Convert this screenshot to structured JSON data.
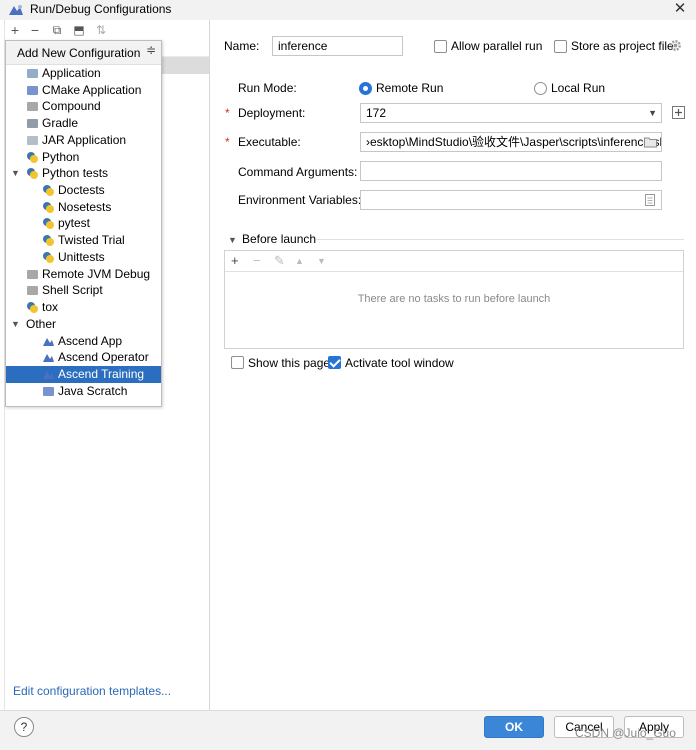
{
  "window": {
    "title": "Run/Debug Configurations",
    "close_glyph": "✕",
    "icon": "ascend-config-icon"
  },
  "left_toolbar": {
    "add_glyph": "+",
    "remove_glyph": "−",
    "copy_glyph": "⧉",
    "move_glyph": "⬒",
    "sort_glyph": "⇅"
  },
  "popup": {
    "title": "Add New Configuration",
    "collapse_glyph": "≑",
    "items": [
      {
        "label": "Application",
        "icon": "application-icon",
        "color": "#6e90b8",
        "level": 1
      },
      {
        "label": "CMake Application",
        "icon": "cmake-icon",
        "color": "#4a70c0",
        "level": 1
      },
      {
        "label": "Compound",
        "icon": "compound-icon",
        "color": "#8b8b8b",
        "level": 1
      },
      {
        "label": "Gradle",
        "icon": "gradle-icon",
        "color": "#6b7b8b",
        "level": 1
      },
      {
        "label": "JAR Application",
        "icon": "jar-icon",
        "color": "#9aa8b8",
        "level": 1
      },
      {
        "label": "Python",
        "icon": "python-icon",
        "color": "#3a76b0",
        "level": 1
      },
      {
        "label": "Python tests",
        "icon": "python-tests-icon",
        "color": "#3a76b0",
        "level": 1,
        "expanded": true
      },
      {
        "label": "Doctests",
        "icon": "python-test-icon",
        "color": "#3a76b0",
        "level": 2
      },
      {
        "label": "Nosetests",
        "icon": "python-test-icon",
        "color": "#3a76b0",
        "level": 2
      },
      {
        "label": "pytest",
        "icon": "python-test-icon",
        "color": "#3a76b0",
        "level": 2
      },
      {
        "label": "Twisted Trial",
        "icon": "python-test-icon",
        "color": "#3a76b0",
        "level": 2
      },
      {
        "label": "Unittests",
        "icon": "python-test-icon",
        "color": "#3a76b0",
        "level": 2
      },
      {
        "label": "Remote JVM Debug",
        "icon": "remote-debug-icon",
        "color": "#8b8b8b",
        "level": 1
      },
      {
        "label": "Shell Script",
        "icon": "shell-script-icon",
        "color": "#8b8b8b",
        "level": 1
      },
      {
        "label": "tox",
        "icon": "tox-icon",
        "color": "#3a76b0",
        "level": 1
      },
      {
        "label": "Other",
        "icon": "",
        "color": "",
        "level": 1,
        "expanded": true,
        "noicon": true
      },
      {
        "label": "Ascend App",
        "icon": "ascend-app-icon",
        "color": "#4a70c0",
        "level": 2
      },
      {
        "label": "Ascend Operator",
        "icon": "ascend-operator-icon",
        "color": "#4a70c0",
        "level": 2
      },
      {
        "label": "Ascend Training",
        "icon": "ascend-training-icon",
        "color": "#4a70c0",
        "level": 2,
        "selected": true
      },
      {
        "label": "Java Scratch",
        "icon": "java-scratch-icon",
        "color": "#4a70c0",
        "level": 2
      }
    ]
  },
  "edit_templates_link": "Edit configuration templates...",
  "form": {
    "name_label": "Name:",
    "name_value": "inference",
    "allow_parallel_label": "Allow parallel run",
    "allow_parallel_checked": false,
    "store_project_label": "Store as project file",
    "store_project_checked": false,
    "run_mode_label": "Run Mode:",
    "remote_run_label": "Remote Run",
    "remote_run_selected": true,
    "local_run_label": "Local Run",
    "local_run_selected": false,
    "required_mark": "*",
    "deployment_label": "Deployment:",
    "deployment_value": "172",
    "executable_label": "Executable:",
    "executable_value": "›esktop\\MindStudio\\验收文件\\Jasper\\scripts\\inference.sh",
    "command_args_label": "Command Arguments:",
    "command_args_value": "",
    "env_vars_label": "Environment Variables:",
    "env_vars_value": ""
  },
  "before_launch": {
    "label": "Before launch",
    "empty_text": "There are no tasks to run before launch",
    "add_glyph": "+",
    "remove_glyph": "−",
    "edit_glyph": "✎",
    "up_glyph": "▲",
    "down_glyph": "▼"
  },
  "options": {
    "show_page_label": "Show this page",
    "show_page_checked": false,
    "activate_tool_label": "Activate tool window",
    "activate_tool_checked": true
  },
  "buttons": {
    "help": "?",
    "ok": "OK",
    "cancel": "Cancel",
    "apply": "Apply"
  },
  "watermark": "CSDN @Juio_Guo",
  "colors": {
    "selection": "#2b6ebf",
    "accent": "#2675d6",
    "primary_button": "#3c86d8",
    "required": "#d32f2f"
  }
}
